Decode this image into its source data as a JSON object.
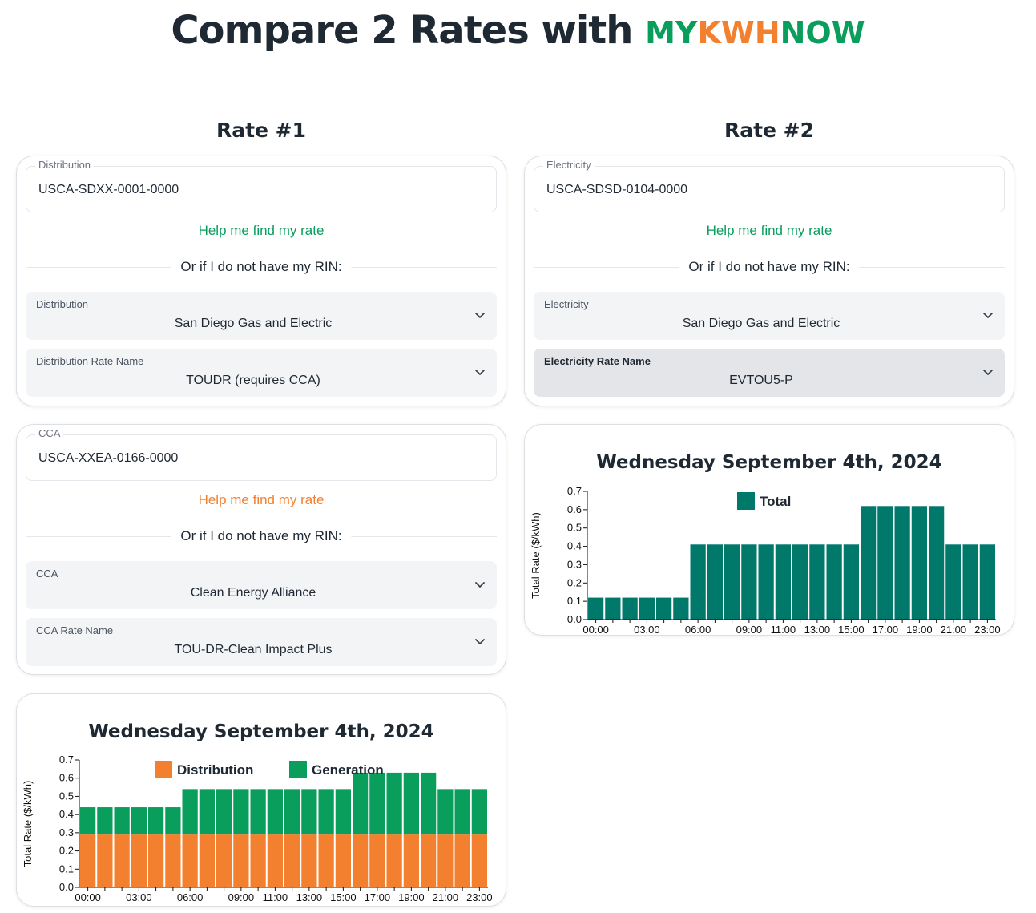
{
  "header": {
    "title_prefix": "Compare 2 Rates with",
    "brand": [
      "MY",
      "KWH",
      "NOW"
    ]
  },
  "rate1": {
    "heading": "Rate #1",
    "distribution_card": {
      "rin_label": "Distribution",
      "rin_value": "USCA-SDXX-0001-0000",
      "help_link": "Help me find my rate",
      "divider_text": "Or if I do not have my RIN:",
      "select1": {
        "label": "Distribution",
        "value": "San Diego Gas and Electric"
      },
      "select2": {
        "label": "Distribution Rate Name",
        "value": "TOUDR (requires CCA)"
      }
    },
    "cca_card": {
      "rin_label": "CCA",
      "rin_value": "USCA-XXEA-0166-0000",
      "help_link": "Help me find my rate",
      "divider_text": "Or if I do not have my RIN:",
      "select1": {
        "label": "CCA",
        "value": "Clean Energy Alliance"
      },
      "select2": {
        "label": "CCA Rate Name",
        "value": "TOU-DR-Clean Impact Plus"
      }
    },
    "chart_title": "Wednesday September 4th, 2024"
  },
  "rate2": {
    "heading": "Rate #2",
    "electricity_card": {
      "rin_label": "Electricity",
      "rin_value": "USCA-SDSD-0104-0000",
      "help_link": "Help me find my rate",
      "divider_text": "Or if I do not have my RIN:",
      "select1": {
        "label": "Electricity",
        "value": "San Diego Gas and Electric"
      },
      "select2": {
        "label": "Electricity Rate Name",
        "value": "EVTOU5-P"
      }
    },
    "chart_title": "Wednesday September 4th, 2024"
  },
  "colors": {
    "green": "#0a9e5c",
    "orange": "#f3802e",
    "teal": "#00796b",
    "dark": "#1f2933"
  },
  "chart_data": [
    {
      "type": "bar",
      "stacked": true,
      "title": "Wednesday September 4th, 2024",
      "ylabel": "Total Rate ($/kWh)",
      "xlabel": "",
      "ylim": [
        0,
        0.7
      ],
      "yticks": [
        "0.0",
        "0.1",
        "0.2",
        "0.3",
        "0.4",
        "0.5",
        "0.6",
        "0.7"
      ],
      "xtick_labels": [
        "00:00",
        "03:00",
        "06:00",
        "09:00",
        "11:00",
        "13:00",
        "15:00",
        "17:00",
        "19:00",
        "21:00",
        "23:00"
      ],
      "xtick_hours": [
        0,
        3,
        6,
        9,
        11,
        13,
        15,
        17,
        19,
        21,
        23
      ],
      "categories": [
        "00:00",
        "01:00",
        "02:00",
        "03:00",
        "04:00",
        "05:00",
        "06:00",
        "07:00",
        "08:00",
        "09:00",
        "10:00",
        "11:00",
        "12:00",
        "13:00",
        "14:00",
        "15:00",
        "16:00",
        "17:00",
        "18:00",
        "19:00",
        "20:00",
        "21:00",
        "22:00",
        "23:00"
      ],
      "legend_position": "top",
      "series": [
        {
          "name": "Distribution",
          "color": "#f3802e",
          "values": [
            0.29,
            0.29,
            0.29,
            0.29,
            0.29,
            0.29,
            0.29,
            0.29,
            0.29,
            0.29,
            0.29,
            0.29,
            0.29,
            0.29,
            0.29,
            0.29,
            0.29,
            0.29,
            0.29,
            0.29,
            0.29,
            0.29,
            0.29,
            0.29
          ]
        },
        {
          "name": "Generation",
          "color": "#0a9e5c",
          "values": [
            0.15,
            0.15,
            0.15,
            0.15,
            0.15,
            0.15,
            0.25,
            0.25,
            0.25,
            0.25,
            0.25,
            0.25,
            0.25,
            0.25,
            0.25,
            0.25,
            0.34,
            0.34,
            0.34,
            0.34,
            0.34,
            0.25,
            0.25,
            0.25
          ]
        }
      ]
    },
    {
      "type": "bar",
      "title": "Wednesday September 4th, 2024",
      "ylabel": "Total Rate ($/kWh)",
      "xlabel": "",
      "ylim": [
        0,
        0.7
      ],
      "yticks": [
        "0.0",
        "0.1",
        "0.2",
        "0.3",
        "0.4",
        "0.5",
        "0.6",
        "0.7"
      ],
      "xtick_labels": [
        "00:00",
        "03:00",
        "06:00",
        "09:00",
        "11:00",
        "13:00",
        "15:00",
        "17:00",
        "19:00",
        "21:00",
        "23:00"
      ],
      "xtick_hours": [
        0,
        3,
        6,
        9,
        11,
        13,
        15,
        17,
        19,
        21,
        23
      ],
      "categories": [
        "00:00",
        "01:00",
        "02:00",
        "03:00",
        "04:00",
        "05:00",
        "06:00",
        "07:00",
        "08:00",
        "09:00",
        "10:00",
        "11:00",
        "12:00",
        "13:00",
        "14:00",
        "15:00",
        "16:00",
        "17:00",
        "18:00",
        "19:00",
        "20:00",
        "21:00",
        "22:00",
        "23:00"
      ],
      "legend_position": "top",
      "series": [
        {
          "name": "Total",
          "color": "#00796b",
          "values": [
            0.12,
            0.12,
            0.12,
            0.12,
            0.12,
            0.12,
            0.41,
            0.41,
            0.41,
            0.41,
            0.41,
            0.41,
            0.41,
            0.41,
            0.41,
            0.41,
            0.62,
            0.62,
            0.62,
            0.62,
            0.62,
            0.41,
            0.41,
            0.41
          ]
        }
      ]
    }
  ]
}
